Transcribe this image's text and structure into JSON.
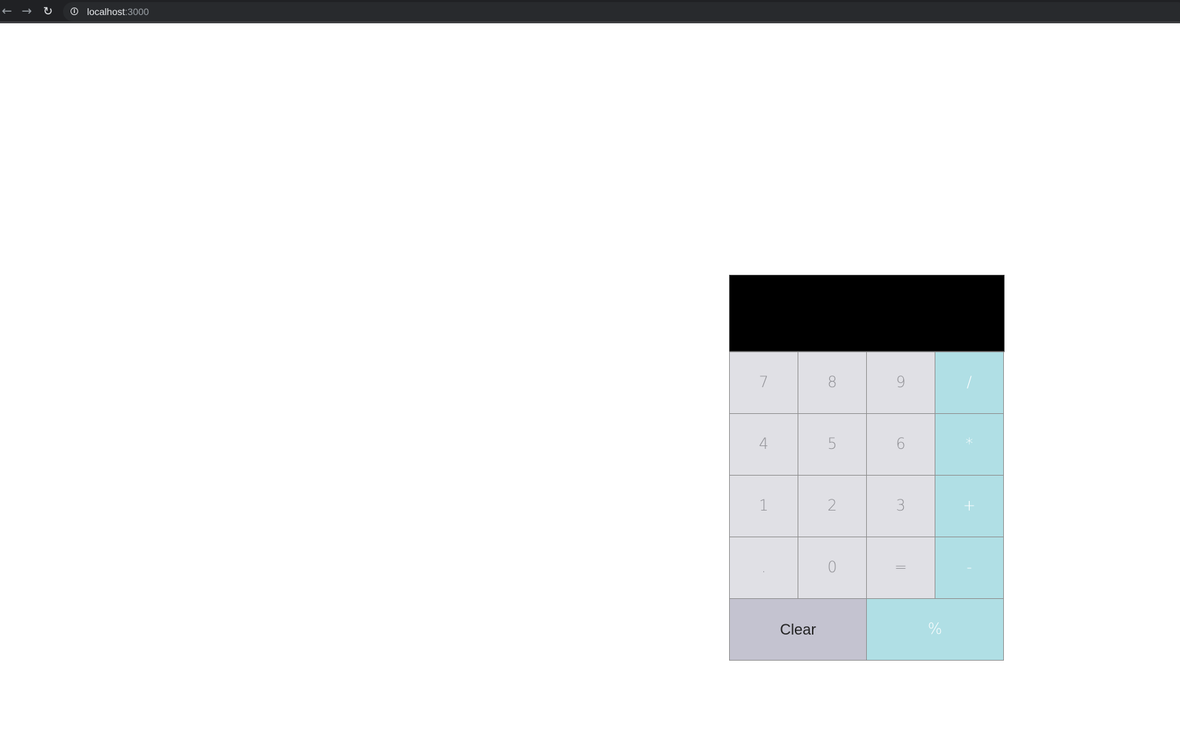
{
  "browser": {
    "back_glyph": "←",
    "forward_glyph": "→",
    "reload_glyph": "↻",
    "info_glyph": "i",
    "url_host": "localhost",
    "url_port": ":3000"
  },
  "calculator": {
    "display_value": "",
    "keys": {
      "k7": "7",
      "k8": "8",
      "k9": "9",
      "divide": "/",
      "k4": "4",
      "k5": "5",
      "k6": "6",
      "multiply": "*",
      "k1": "1",
      "k2": "2",
      "k3": "3",
      "plus": "+",
      "decimal": ".",
      "k0": "0",
      "equals": "=",
      "minus": "-",
      "clear": "Clear",
      "percent": "%"
    }
  },
  "colors": {
    "display_bg": "#000000",
    "digit_key_bg": "#e0e0e5",
    "operator_key_bg": "#b0dfe5",
    "clear_key_bg": "#c4c3d0",
    "browser_bar_bg": "#202124"
  },
  "icons": {
    "back": "arrow-left-icon",
    "forward": "arrow-right-icon",
    "reload": "reload-icon",
    "info": "info-icon"
  }
}
